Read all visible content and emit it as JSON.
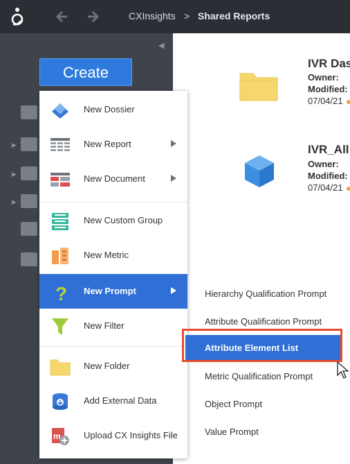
{
  "topbar": {
    "breadcrumb_app": "CXInsights",
    "breadcrumb_sep": ">",
    "breadcrumb_current": "Shared Reports",
    "back_icon": "back-arrow-icon",
    "forward_icon": "forward-arrow-icon"
  },
  "sidebar": {
    "create_label": "Create"
  },
  "content": {
    "items": [
      {
        "title": "IVR Das",
        "owner_label": "Owner:",
        "modified_label": "Modified:",
        "date": "07/04/21",
        "icon": "folder-icon"
      },
      {
        "title": "IVR_All",
        "owner_label": "Owner:",
        "modified_label": "Modified:",
        "date": "07/04/21",
        "icon": "cube-icon"
      }
    ]
  },
  "create_menu": {
    "items": [
      {
        "label": "New Dossier",
        "icon": "dossier-icon",
        "has_submenu": false
      },
      {
        "label": "New Report",
        "icon": "report-grid-icon",
        "has_submenu": true
      },
      {
        "label": "New Document",
        "icon": "document-icon",
        "has_submenu": true
      },
      {
        "label": "New Custom Group",
        "icon": "custom-group-icon",
        "has_submenu": false
      },
      {
        "label": "New Metric",
        "icon": "metric-icon",
        "has_submenu": false
      },
      {
        "label": "New Prompt",
        "icon": "prompt-question-icon",
        "has_submenu": true,
        "active": true
      },
      {
        "label": "New Filter",
        "icon": "filter-funnel-icon",
        "has_submenu": false
      },
      {
        "label": "New Folder",
        "icon": "folder-icon",
        "has_submenu": false
      },
      {
        "label": "Add External Data",
        "icon": "database-add-icon",
        "has_submenu": false
      },
      {
        "label": "Upload CX Insights File",
        "icon": "upload-file-icon",
        "has_submenu": false
      }
    ]
  },
  "prompt_submenu": {
    "items": [
      {
        "label": "Hierarchy Qualification Prompt"
      },
      {
        "label": "Attribute Qualification Prompt"
      },
      {
        "label": "Attribute Element List",
        "selected": true
      },
      {
        "label": "Metric Qualification Prompt"
      },
      {
        "label": "Object Prompt"
      },
      {
        "label": "Value Prompt"
      }
    ]
  },
  "colors": {
    "accent": "#2f6fd6",
    "highlight_border": "#e84c2a",
    "sidebar_bg": "#3f434b",
    "topbar_bg": "#2b2e35"
  }
}
